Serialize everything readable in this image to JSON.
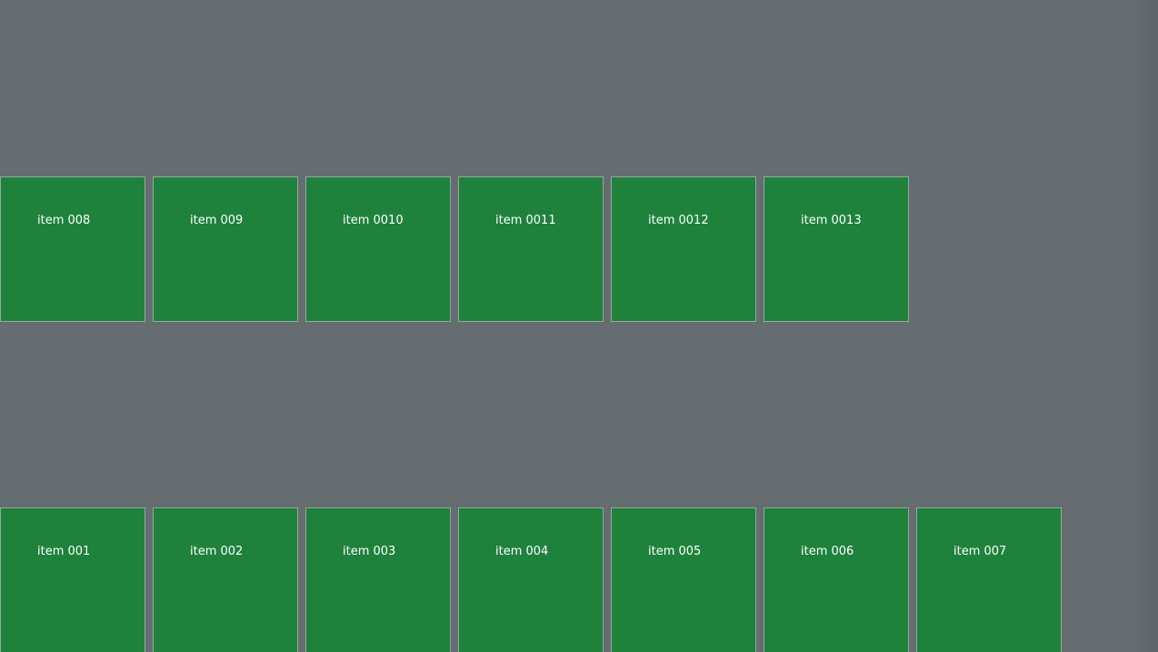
{
  "rows": {
    "top": {
      "items": [
        {
          "label": "item 008"
        },
        {
          "label": "item 009"
        },
        {
          "label": "item 0010"
        },
        {
          "label": "item 0011"
        },
        {
          "label": "item 0012"
        },
        {
          "label": "item 0013"
        }
      ]
    },
    "bottom": {
      "items": [
        {
          "label": "item 001"
        },
        {
          "label": "item 002"
        },
        {
          "label": "item 003"
        },
        {
          "label": "item 004"
        },
        {
          "label": "item 005"
        },
        {
          "label": "item 006"
        },
        {
          "label": "item 007"
        }
      ]
    }
  },
  "colors": {
    "background": "#656d70",
    "tile": "#1e823c",
    "tile_border": "#96a89c",
    "text": "#ffffff"
  }
}
